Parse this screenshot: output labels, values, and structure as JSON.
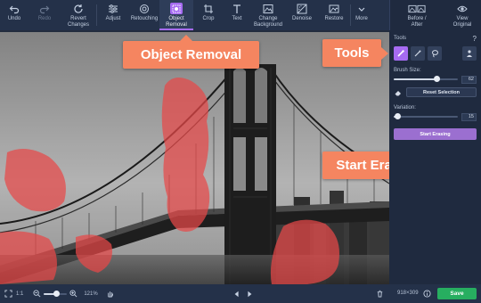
{
  "toolbar": {
    "undo": "Undo",
    "redo": "Redo",
    "revert": "Revert Changes",
    "adjust": "Adjust",
    "retouching": "Retouching",
    "object_removal": "Object Removal",
    "crop": "Crop",
    "text": "Text",
    "change_background": "Change Background",
    "denoise": "Denoise",
    "restore": "Restore",
    "more": "More",
    "before_after": "Before / After",
    "view_original": "View Original"
  },
  "callouts": {
    "object_removal": "Object Removal",
    "tools": "Tools",
    "start_erasing": "Start Erasing"
  },
  "panel": {
    "tools_label": "Tools",
    "help": "?",
    "brush_size_label": "Brush Size:",
    "brush_size_value": "62",
    "brush_size_fraction": 0.68,
    "reset_selection": "Reset Selection",
    "variation_label": "Variation:",
    "variation_value": "15",
    "variation_fraction": 0.06,
    "start_erasing": "Start Erasing"
  },
  "status": {
    "fit": "1:1",
    "zoom": "121%",
    "zoom_fraction": 0.55,
    "dimensions": "918×309",
    "save": "Save"
  },
  "colors": {
    "accent": "#a66bf2",
    "callout": "#f58560",
    "save": "#27ae60",
    "mask": "#e84848"
  }
}
